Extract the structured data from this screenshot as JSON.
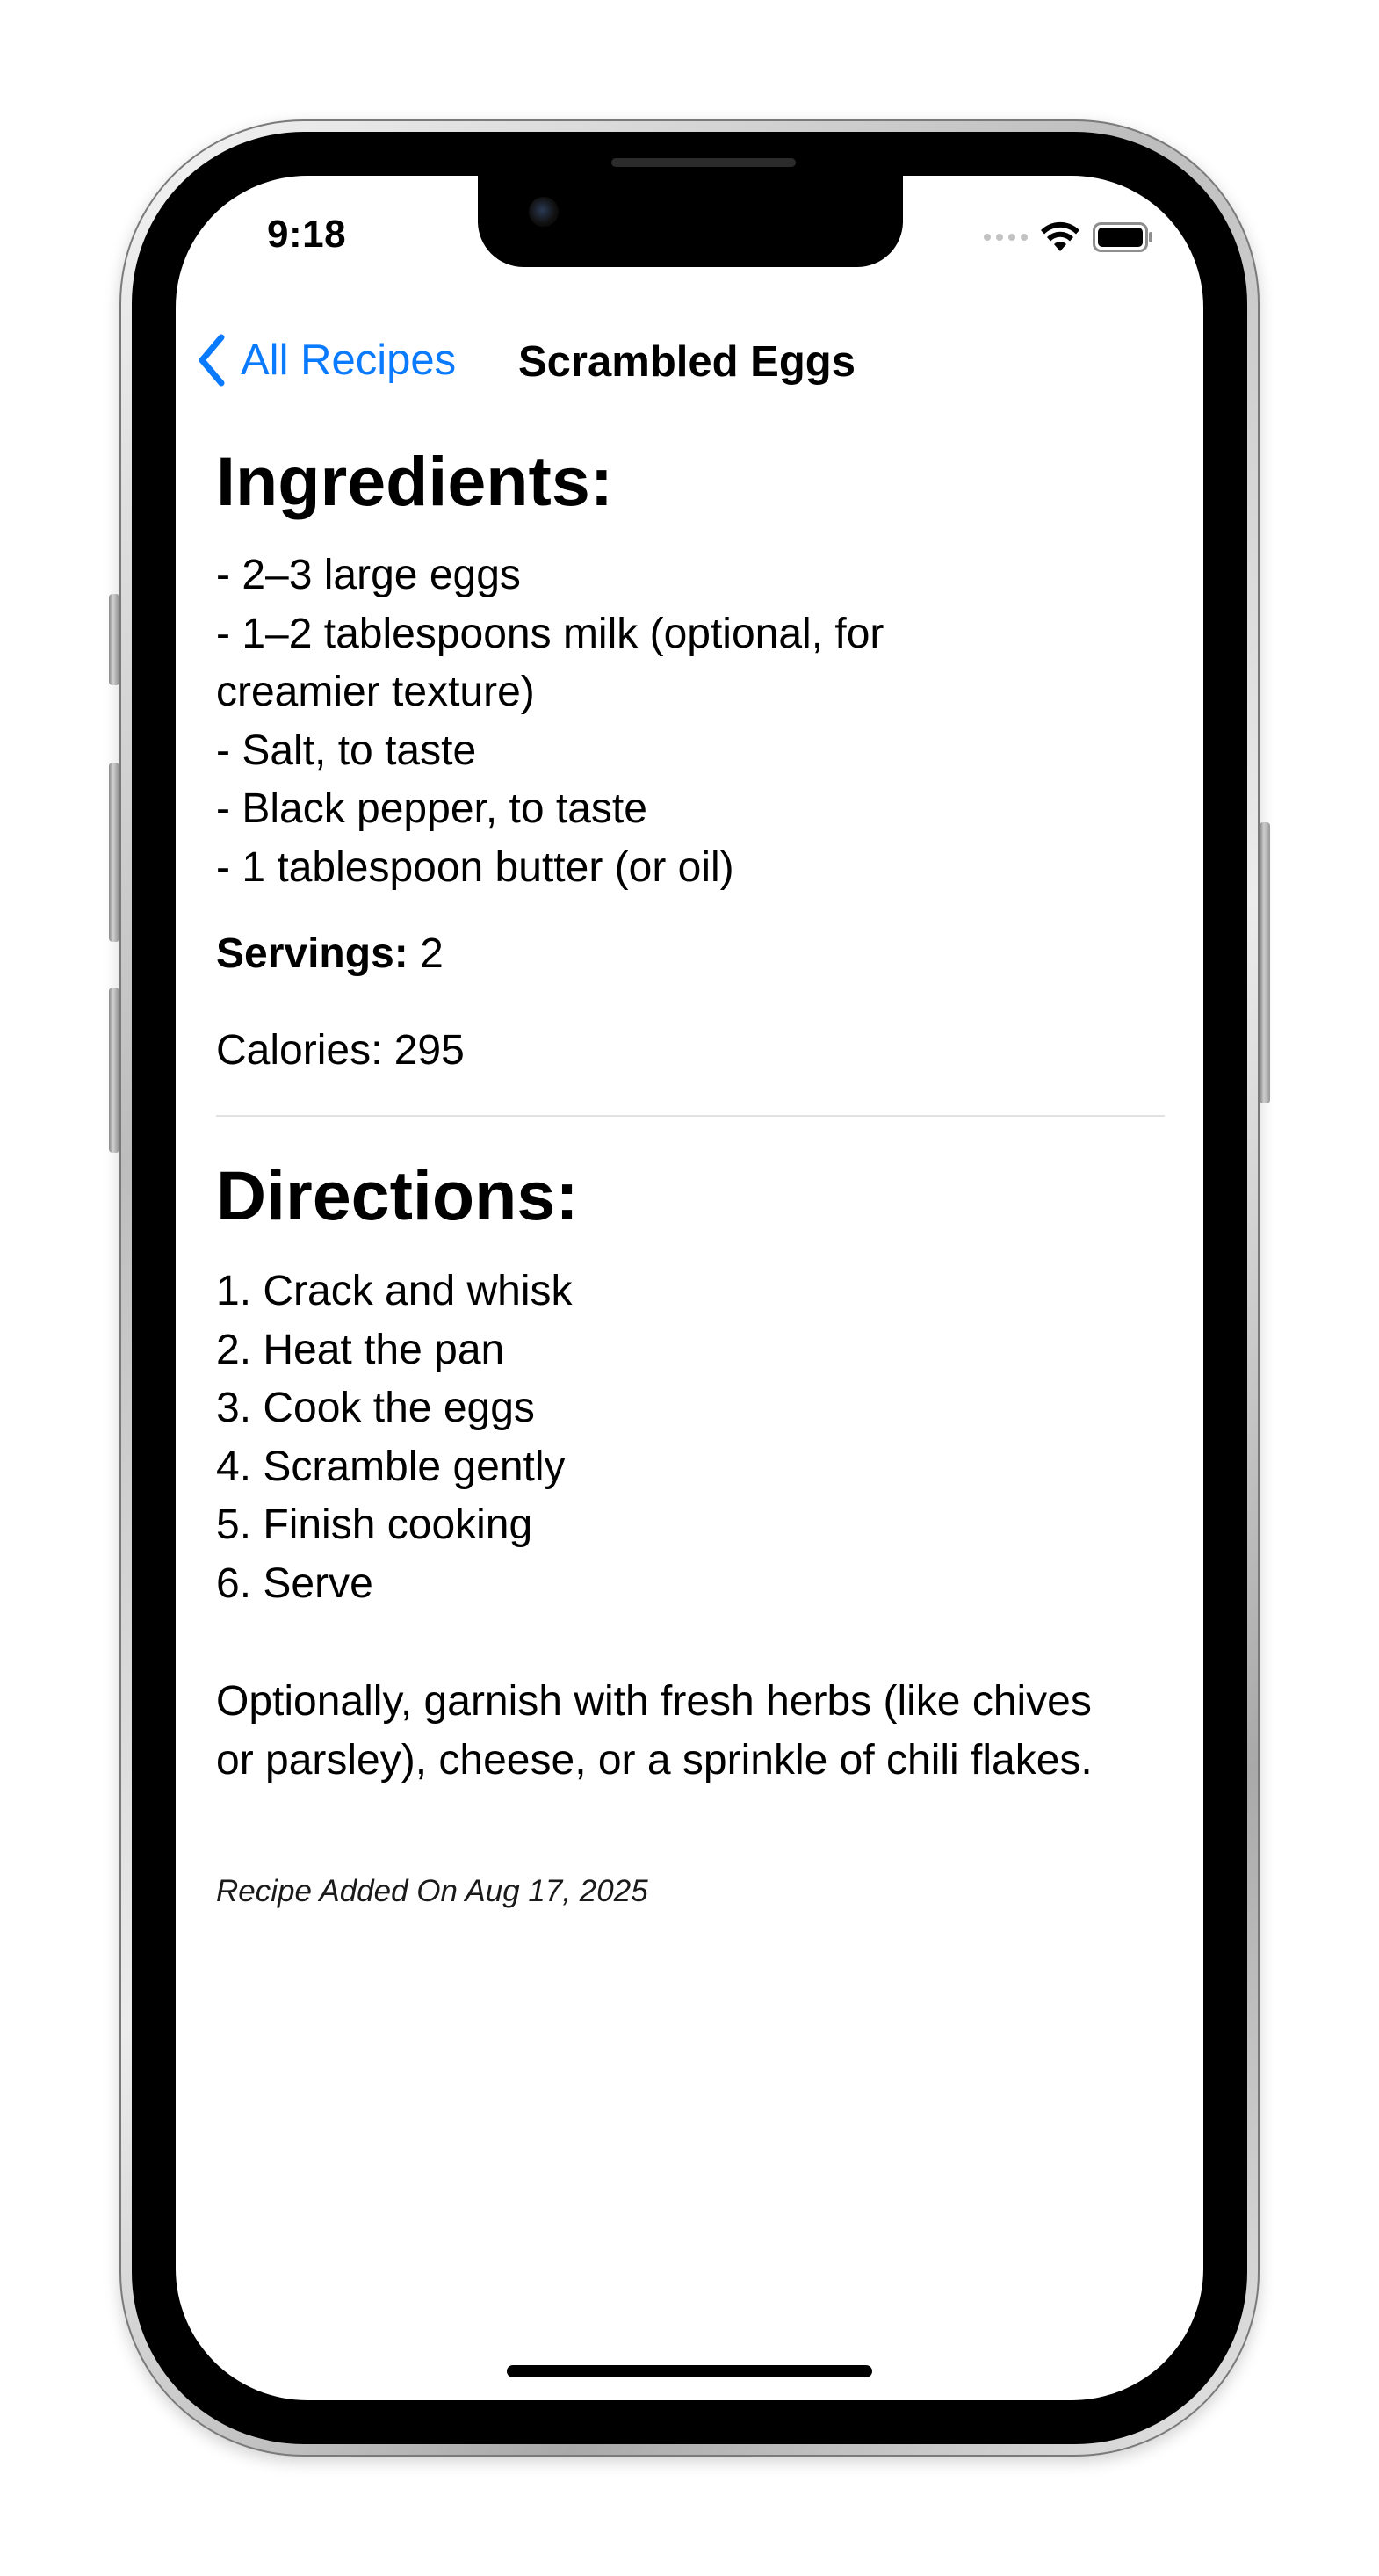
{
  "status_bar": {
    "time": "9:18"
  },
  "nav": {
    "back_label": "All Recipes",
    "title": "Scrambled Eggs"
  },
  "recipe": {
    "ingredients_heading": "Ingredients:",
    "ingredients": [
      "- 2–3 large eggs",
      "- 1–2 tablespoons milk (optional, for",
      "creamier texture)",
      "- Salt, to taste",
      "- Black pepper, to taste",
      "- 1 tablespoon butter (or oil)"
    ],
    "servings_label": "Servings:",
    "servings_value": " 2",
    "calories": "Calories: 295",
    "directions_heading": "Directions:",
    "steps": [
      "1. Crack and whisk",
      "2. Heat the pan",
      "3. Cook the eggs",
      "4. Scramble gently",
      "5. Finish cooking",
      "6. Serve"
    ],
    "note_lines": [
      "Optionally, garnish with fresh herbs (like chives",
      "or parsley), cheese, or a sprinkle of chili flakes."
    ],
    "added_on": "Recipe Added On Aug 17, 2025"
  },
  "colors": {
    "accent": "#0a7aff",
    "text": "#000000",
    "background": "#ffffff",
    "divider": "#e2e2e2"
  },
  "icons": {
    "back": "chevron-left-icon",
    "wifi": "wifi-icon",
    "battery": "battery-icon",
    "signal": "cellular-signal-icon"
  }
}
